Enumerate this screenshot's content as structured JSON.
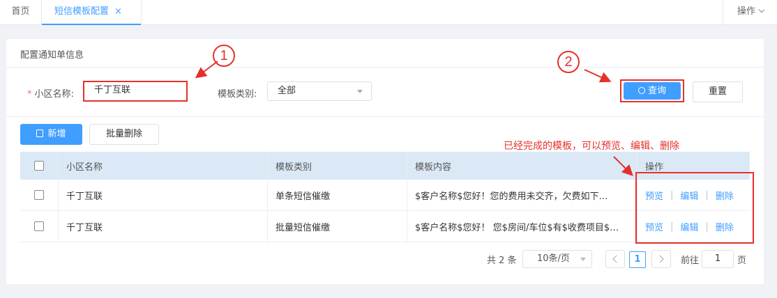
{
  "tabs": {
    "home": "首页",
    "active": "短信模板配置",
    "close_icon": "×",
    "ops": "操作"
  },
  "card": {
    "title": "配置通知单信息"
  },
  "filters": {
    "required_mark": "*",
    "community_label": "小区名称:",
    "community_value": "千丁互联",
    "category_label": "模板类别:",
    "category_value": "全部",
    "search_label": "查询",
    "reset_label": "重置"
  },
  "actions": {
    "add_label": "新增",
    "batch_delete_label": "批量删除"
  },
  "table": {
    "headers": [
      "小区名称",
      "模板类别",
      "模板内容",
      "操作"
    ],
    "rows": [
      {
        "community": "千丁互联",
        "category": "单条短信催缴",
        "content": "$客户名称$您好！您的费用未交齐，欠费如下…",
        "ops": [
          "预览",
          "编辑",
          "删除"
        ]
      },
      {
        "community": "千丁互联",
        "category": "批量短信催缴",
        "content": "$客户名称$您好！ 您$房间/车位$有$收费项目$…",
        "ops": [
          "预览",
          "编辑",
          "删除"
        ]
      }
    ],
    "op_separator": "|"
  },
  "pagination": {
    "total": "共 2 条",
    "page_size": "10条/页",
    "current_page": "1",
    "goto_prefix": "前往",
    "goto_value": "1",
    "goto_suffix": "页"
  },
  "annotations": {
    "marker_1": "1",
    "marker_2": "2",
    "note": "已经完成的模板，可以预览、编辑、删除",
    "color": "#e5302a"
  },
  "colors": {
    "primary": "#409eff",
    "header_bg": "#dbe9f6"
  }
}
